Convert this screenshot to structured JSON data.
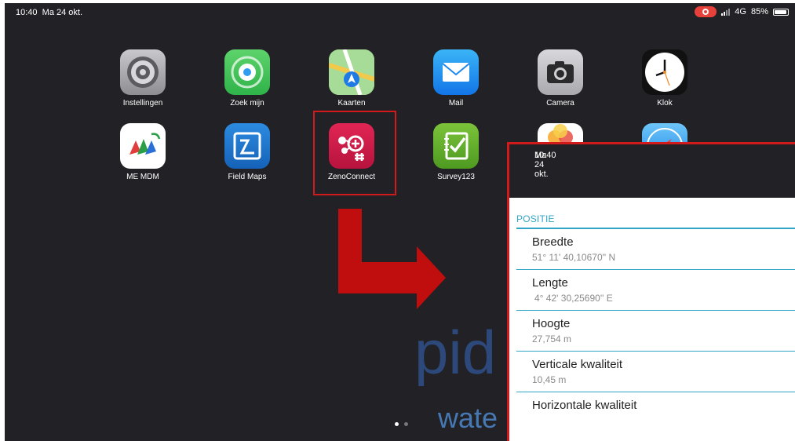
{
  "statusbar": {
    "time": "10:40",
    "date": "Ma 24 okt.",
    "network": "4G",
    "battery": "85%"
  },
  "apps": [
    {
      "label": "Instellingen",
      "icon": "settings-icon"
    },
    {
      "label": "Zoek mijn",
      "icon": "find-my-icon"
    },
    {
      "label": "Kaarten",
      "icon": "maps-icon"
    },
    {
      "label": "Mail",
      "icon": "mail-icon"
    },
    {
      "label": "Camera",
      "icon": "camera-icon"
    },
    {
      "label": "Klok",
      "icon": "clock-icon"
    },
    {
      "label": "ME MDM",
      "icon": "me-mdm-icon"
    },
    {
      "label": "Field Maps",
      "icon": "field-maps-icon"
    },
    {
      "label": "ZenoConnect",
      "icon": "zenoconnect-icon"
    },
    {
      "label": "Survey123",
      "icon": "survey123-icon"
    }
  ],
  "watermark": {
    "line1": "pid",
    "line2": "wate"
  },
  "panel": {
    "time": "10:40",
    "date": "Ma 24 okt.",
    "section": "POSITIE",
    "rows": [
      {
        "title": "Breedte",
        "value": "51° 11' 40,10670'' N"
      },
      {
        "title": "Lengte",
        "value": "4° 42' 30,25690'' E"
      },
      {
        "title": "Hoogte",
        "value": "27,754 m"
      },
      {
        "title": "Verticale kwaliteit",
        "value": "10,45 m"
      },
      {
        "title": "Horizontale kwaliteit",
        "value": ""
      }
    ]
  },
  "colors": {
    "highlight": "#d31a1a",
    "accent": "#30a5c6",
    "background": "#222226"
  }
}
